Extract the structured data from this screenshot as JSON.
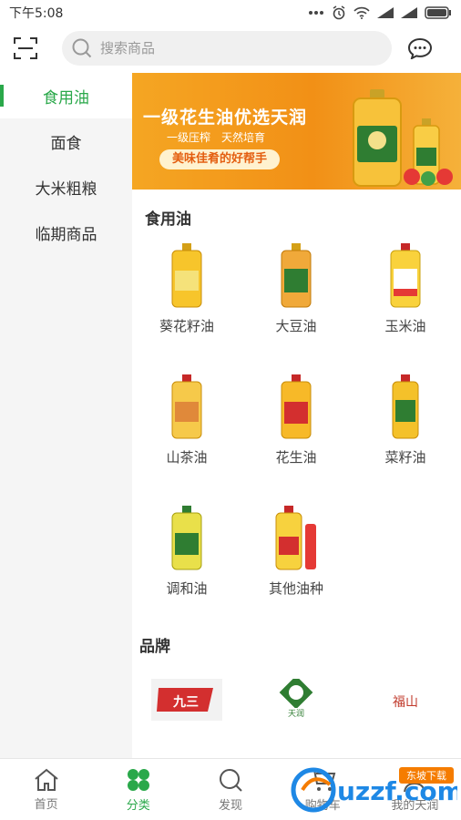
{
  "status": {
    "time": "下午5:08"
  },
  "search": {
    "placeholder": "搜索商品"
  },
  "sidebar": {
    "items": [
      {
        "label": "食用油",
        "active": true
      },
      {
        "label": "面食"
      },
      {
        "label": "大米粗粮"
      },
      {
        "label": "临期商品"
      }
    ]
  },
  "banner": {
    "title": "一级花生油优选天润",
    "sub1": "一级压榨",
    "sub2": "天然培育",
    "tag": "美味佳肴的好帮手"
  },
  "section": {
    "title": "食用油",
    "items": [
      {
        "label": "葵花籽油"
      },
      {
        "label": "大豆油"
      },
      {
        "label": "玉米油"
      },
      {
        "label": "山茶油"
      },
      {
        "label": "花生油"
      },
      {
        "label": "菜籽油"
      },
      {
        "label": "调和油"
      },
      {
        "label": "其他油种"
      }
    ]
  },
  "brands": {
    "title": "品牌",
    "items": [
      {
        "logo_text": "九三"
      },
      {
        "logo_text": "天润"
      },
      {
        "logo_text": "福山"
      }
    ]
  },
  "nav": {
    "items": [
      {
        "label": "首页"
      },
      {
        "label": "分类",
        "active": true
      },
      {
        "label": "发现"
      },
      {
        "label": "购物车"
      },
      {
        "label": "我的天润"
      }
    ]
  },
  "watermark": {
    "text": "uzzf.com",
    "tag": "东坡下载"
  },
  "colors": {
    "accent": "#2aa84a",
    "banner": "#f29016"
  }
}
